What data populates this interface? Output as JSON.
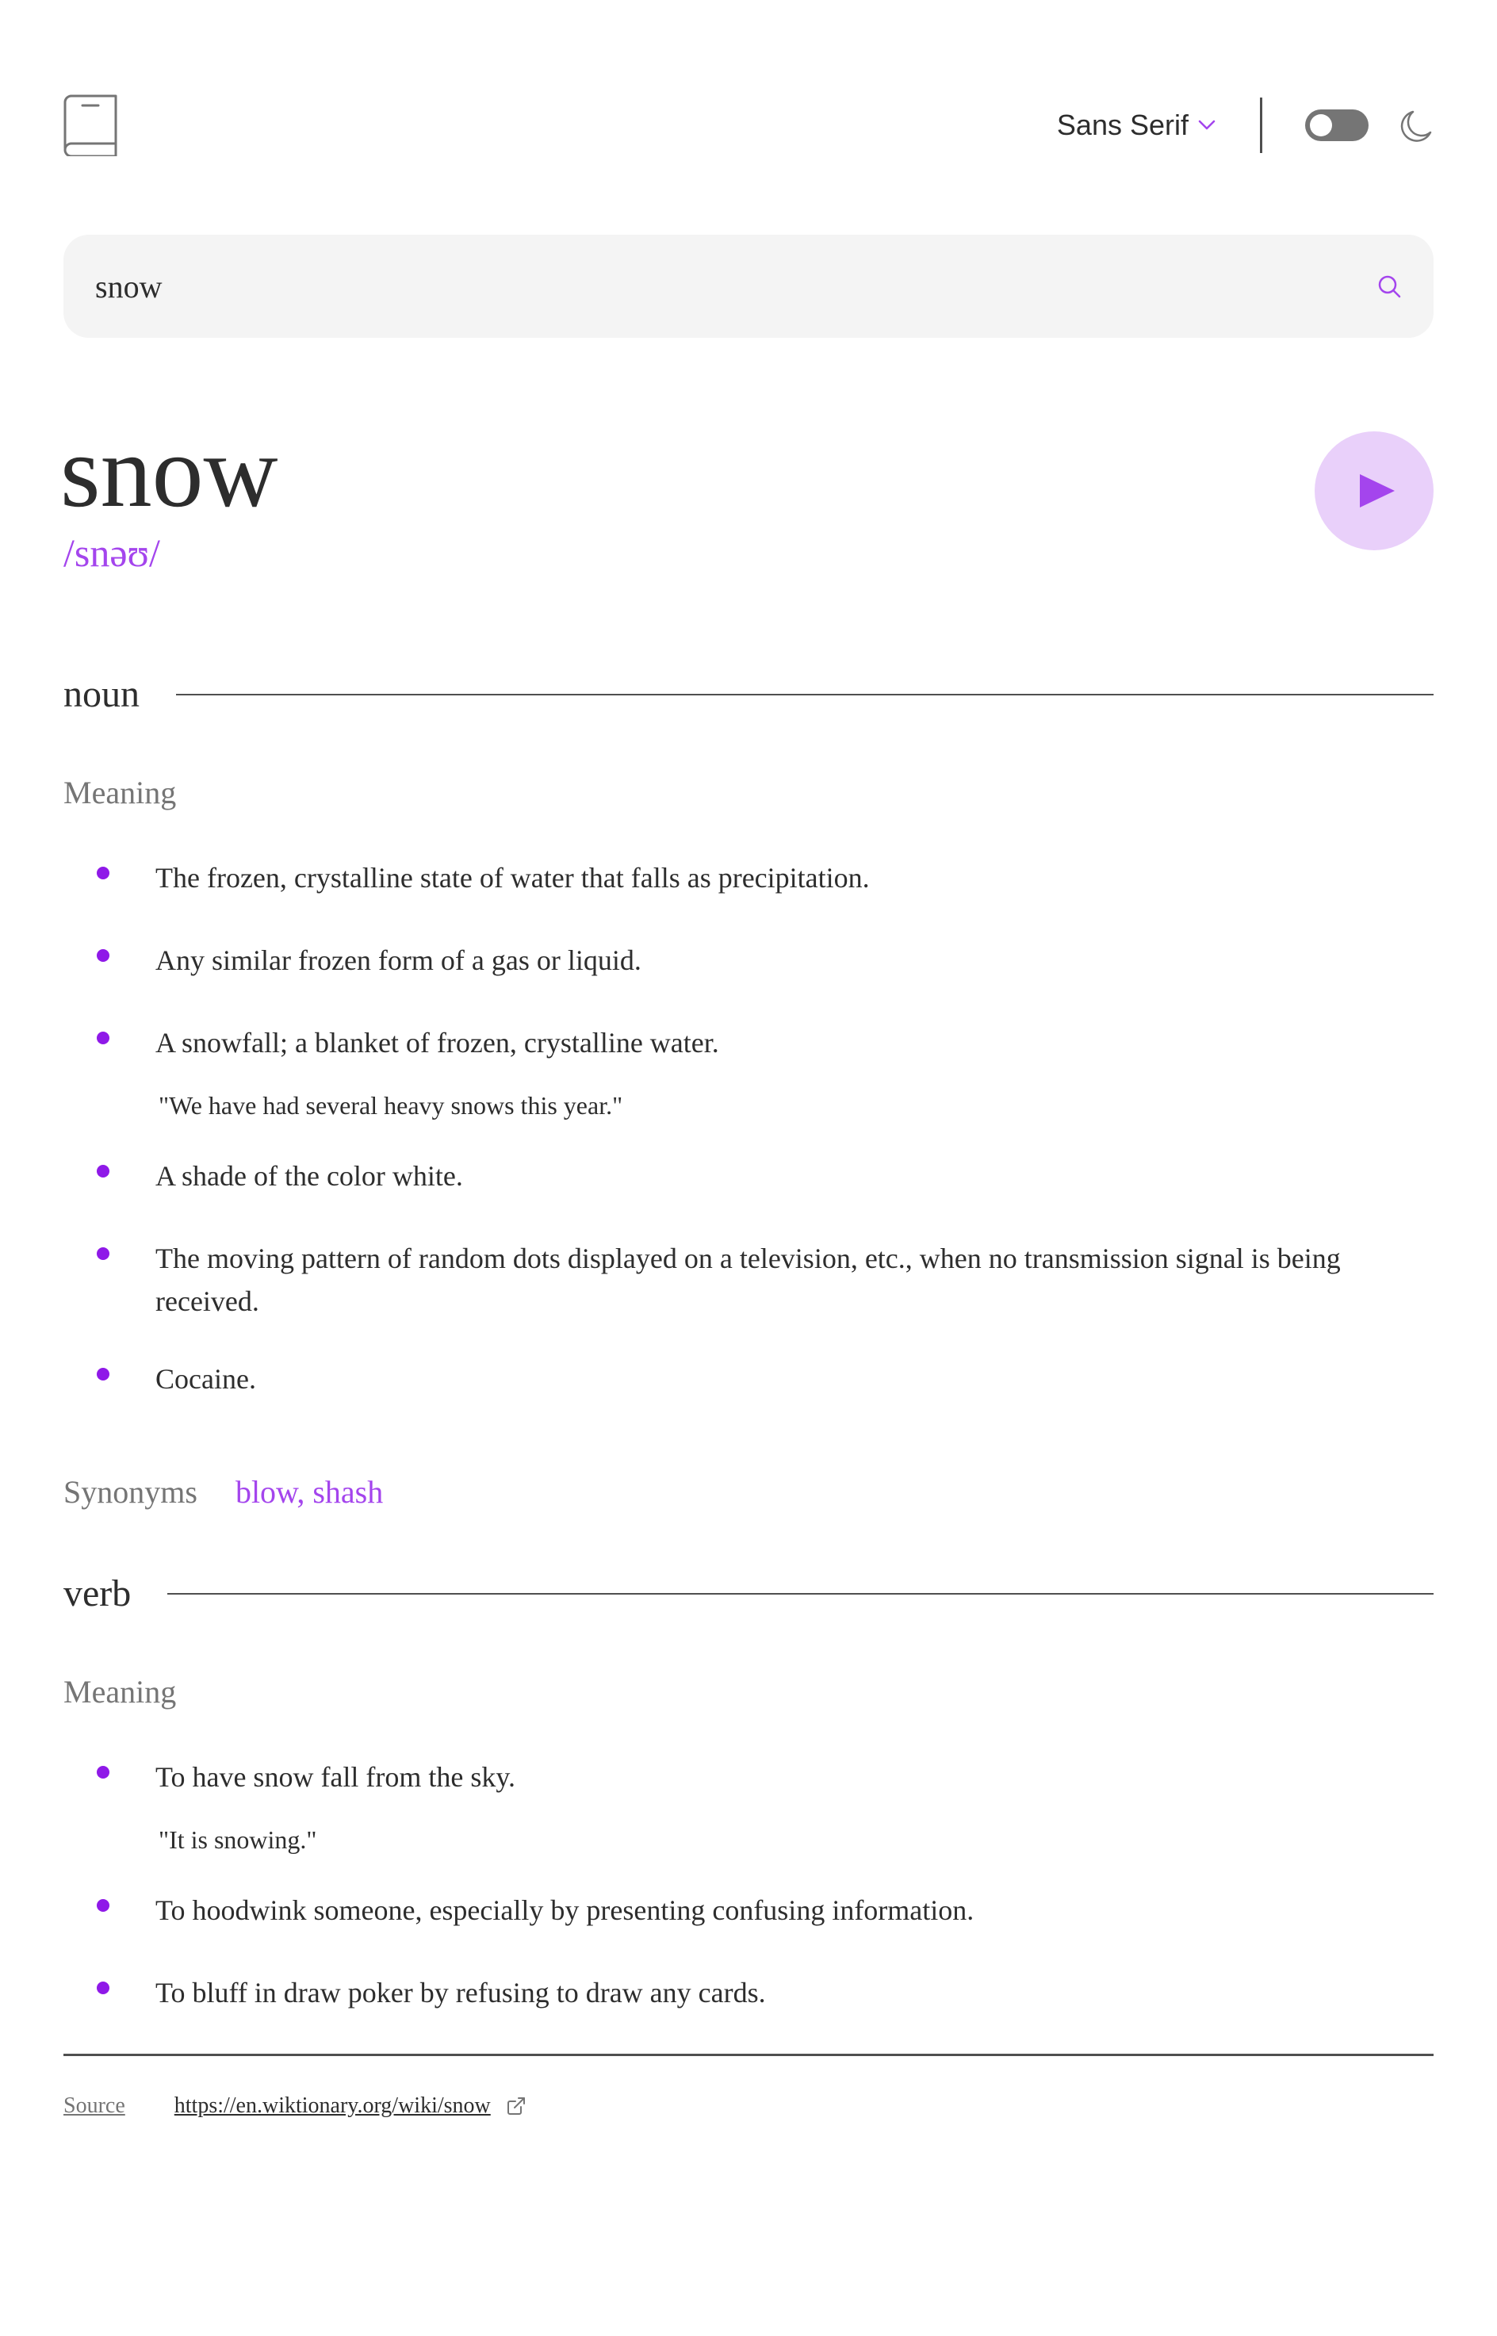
{
  "header": {
    "logo_icon": "book-icon",
    "font_select": {
      "selected": "Sans Serif",
      "icon": "chevron-down-icon"
    },
    "theme_toggle": {
      "state": "off",
      "icon": "moon-icon"
    }
  },
  "search": {
    "value": "snow",
    "icon": "search-icon"
  },
  "entry": {
    "word": "snow",
    "phonetic": "/snəʊ/",
    "play_icon": "play-icon"
  },
  "noun": {
    "label": "noun",
    "meaning_heading": "Meaning",
    "definitions": [
      {
        "text": "The frozen, crystalline state of water that falls as precipitation."
      },
      {
        "text": "Any similar frozen form of a gas or liquid."
      },
      {
        "text": "A snowfall; a blanket of frozen, crystalline water.",
        "example": "\"We have had several heavy snows this year.\""
      },
      {
        "text": "A shade of the color white."
      },
      {
        "text": "The moving pattern of random dots displayed on a television, etc., when no transmission signal is being received."
      },
      {
        "text": "Cocaine."
      }
    ],
    "synonyms_label": "Synonyms",
    "synonyms": "blow, shash"
  },
  "verb": {
    "label": "verb",
    "meaning_heading": "Meaning",
    "definitions": [
      {
        "text": "To have snow fall from the sky.",
        "example": "\"It is snowing.\""
      },
      {
        "text": "To hoodwink someone, especially by presenting confusing information."
      },
      {
        "text": "To bluff in draw poker by refusing to draw any cards."
      }
    ]
  },
  "footer": {
    "source_label": "Source",
    "source_url": "https://en.wiktionary.org/wiki/snow",
    "link_icon": "external-link-icon"
  },
  "colors": {
    "accent": "#a445ed",
    "bullet": "#8f19e8",
    "play_bg": "#e9d0fa",
    "muted": "#757575",
    "text": "#2d2d2d"
  }
}
